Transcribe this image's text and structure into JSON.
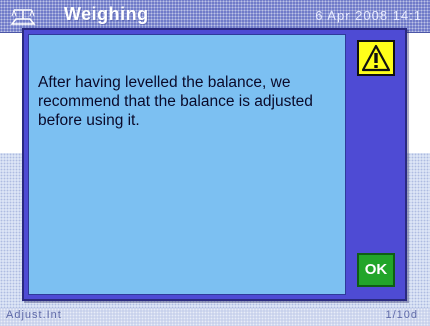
{
  "window": {
    "title": "Weighing",
    "date": "6 Apr 2008 14:1"
  },
  "dialog": {
    "message": "After having levelled the balance, we recommend that the balance is adjusted before using it.",
    "ok_label": "OK",
    "icon": "warning-icon"
  },
  "statusbar": {
    "left": "Adjust.Int",
    "right": "1/10d"
  },
  "colors": {
    "title_bar": "#6d79c8",
    "dialog_frame": "#4e4bd4",
    "dialog_body": "#7cc0f2",
    "warning": "#ffff1a",
    "ok_button": "#22a52a"
  }
}
